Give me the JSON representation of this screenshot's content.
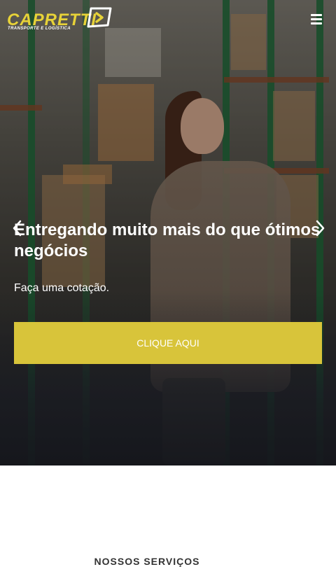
{
  "brand": {
    "name": "CAPRETTI",
    "tagline": "TRANSPORTE E LOGÍSTICA",
    "accent_color": "#d8c43a",
    "logo_color": "#e7d238"
  },
  "header": {
    "menu_icon": "hamburger-icon"
  },
  "hero": {
    "title": "Entregando muito mais do que ótimos negócios",
    "subtitle": "Faça uma cotação.",
    "cta_label": "Clique aqui",
    "prev_icon": "chevron-left-icon",
    "next_icon": "chevron-right-icon"
  },
  "services": {
    "heading": "NOSSOS SERVIÇOS"
  }
}
